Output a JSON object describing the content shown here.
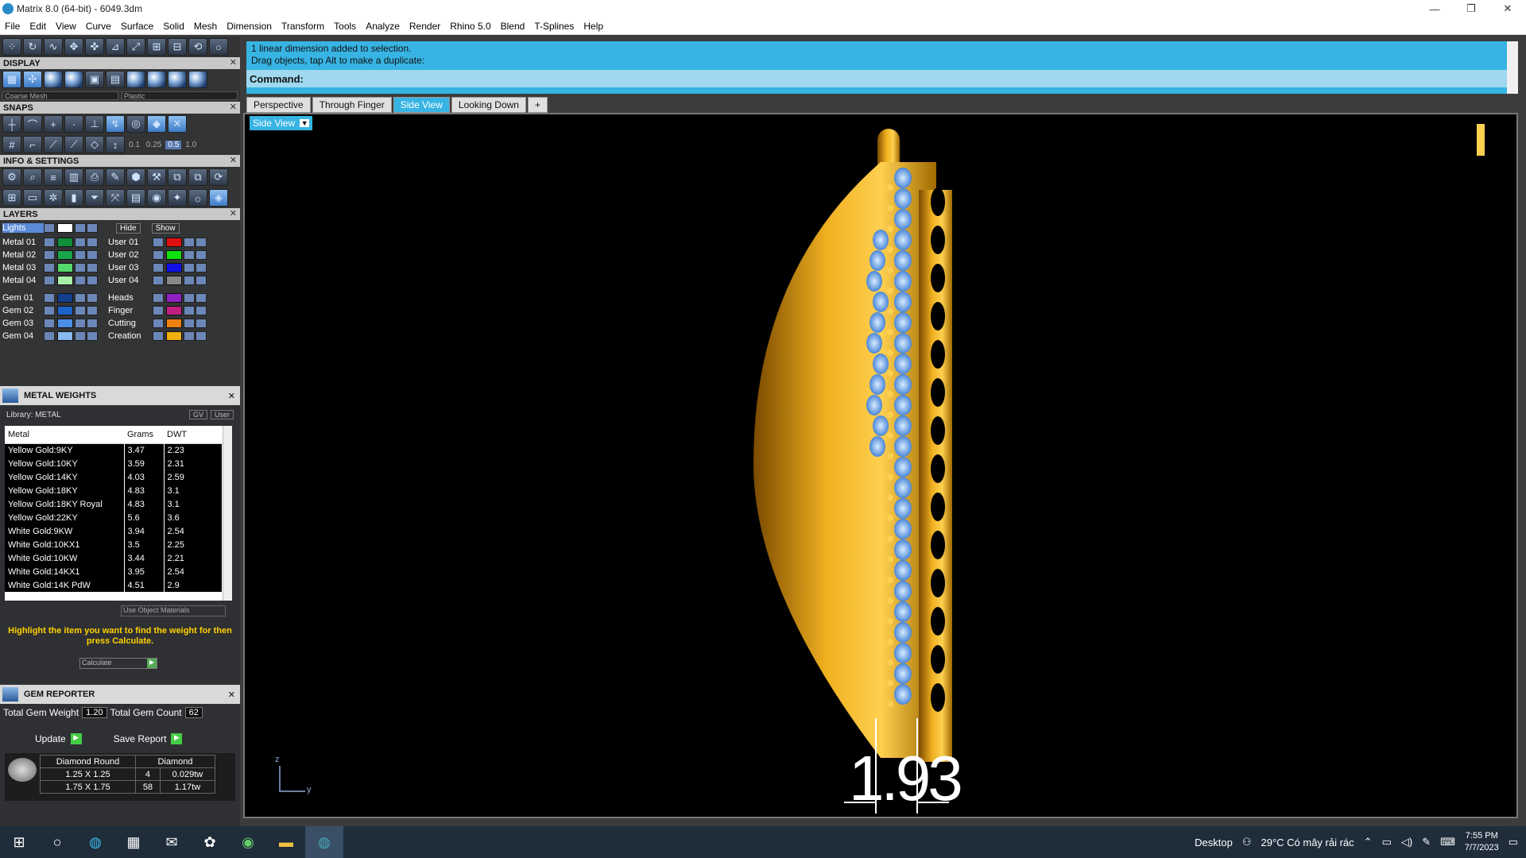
{
  "window": {
    "title": "Matrix 8.0 (64-bit) - 6049.3dm",
    "minimize": "—",
    "restore": "❐",
    "close": "✕"
  },
  "menu": [
    "File",
    "Edit",
    "View",
    "Curve",
    "Surface",
    "Solid",
    "Mesh",
    "Dimension",
    "Transform",
    "Tools",
    "Analyze",
    "Render",
    "Rhino 5.0",
    "Blend",
    "T-Splines",
    "Help"
  ],
  "display": {
    "header": "DISPLAY",
    "mesh_dd": "Coarse Mesh",
    "mat_dd": "Plastic"
  },
  "snaps": {
    "header": "SNAPS",
    "values": [
      "0.1",
      "0.25",
      "0.5",
      "1.0"
    ]
  },
  "info": {
    "header": "INFO & SETTINGS"
  },
  "layers": {
    "header": "LAYERS",
    "lights": "Lights",
    "hide": "Hide",
    "show": "Show",
    "left": [
      {
        "name": "Metal 01",
        "color": "#0f8f3a"
      },
      {
        "name": "Metal 02",
        "color": "#1aa54a"
      },
      {
        "name": "Metal 03",
        "color": "#55d86a"
      },
      {
        "name": "Metal 04",
        "color": "#a8f0a8"
      },
      {
        "name": "Gem 01",
        "color": "#123e8c"
      },
      {
        "name": "Gem 02",
        "color": "#1b63c8"
      },
      {
        "name": "Gem 03",
        "color": "#4c8fe6"
      },
      {
        "name": "Gem 04",
        "color": "#8ab8f0"
      }
    ],
    "right": [
      {
        "name": "User 01",
        "color": "#e01010"
      },
      {
        "name": "User 02",
        "color": "#10e010"
      },
      {
        "name": "User 03",
        "color": "#1010e8"
      },
      {
        "name": "User 04",
        "color": "#888888"
      },
      {
        "name": "Heads",
        "color": "#9020c0"
      },
      {
        "name": "Finger",
        "color": "#c02080"
      },
      {
        "name": "Cutting",
        "color": "#f08010"
      },
      {
        "name": "Creation",
        "color": "#f0b010"
      }
    ]
  },
  "metal_weights": {
    "title": "METAL WEIGHTS",
    "library": "Library: METAL",
    "gv": "GV",
    "user": "User",
    "headers": [
      "Metal",
      "Grams",
      "DWT"
    ],
    "rows": [
      [
        "Yellow Gold:9KY",
        "3.47",
        "2.23"
      ],
      [
        "Yellow Gold:10KY",
        "3.59",
        "2.31"
      ],
      [
        "Yellow Gold:14KY",
        "4.03",
        "2.59"
      ],
      [
        "Yellow Gold:18KY",
        "4.83",
        "3.1"
      ],
      [
        "Yellow Gold:18KY Royal",
        "4.83",
        "3.1"
      ],
      [
        "Yellow Gold:22KY",
        "5.6",
        "3.6"
      ],
      [
        "White Gold:9KW",
        "3.94",
        "2.54"
      ],
      [
        "White Gold:10KX1",
        "3.5",
        "2.25"
      ],
      [
        "White Gold:10KW",
        "3.44",
        "2.21"
      ],
      [
        "White Gold:14KX1",
        "3.95",
        "2.54"
      ],
      [
        "White Gold:14K PdW",
        "4.51",
        "2.9"
      ]
    ],
    "use_object": "Use Object Materials",
    "hint": "Highlight the item you want to find the weight for then press Calculate.",
    "calculate": "Calculate"
  },
  "gem_reporter": {
    "title": "GEM REPORTER",
    "weight_label": "Total Gem Weight",
    "weight": "1.20",
    "count_label": "Total Gem Count",
    "count": "62",
    "update": "Update",
    "save": "Save Report",
    "cols": [
      "Diamond Round",
      "Diamond"
    ],
    "rows": [
      [
        "1.25 X 1.25",
        "4",
        "0.029tw"
      ],
      [
        "1.75 X 1.75",
        "58",
        "1.17tw"
      ]
    ]
  },
  "command": {
    "line1": "1 linear dimension added to selection.",
    "line2": "Drag objects, tap Alt to make a duplicate:",
    "prompt": "Command:"
  },
  "tabs": [
    "Perspective",
    "Through Finger",
    "Side View",
    "Looking Down",
    "+"
  ],
  "active_tab": "Side View",
  "viewport": {
    "label": "Side View",
    "dimension": "1.93",
    "axis_z": "z",
    "axis_y": "y"
  },
  "taskbar": {
    "desktop": "Desktop",
    "weather": "29°C  Có mây rải rác",
    "time": "7:55 PM",
    "date": "7/7/2023"
  }
}
